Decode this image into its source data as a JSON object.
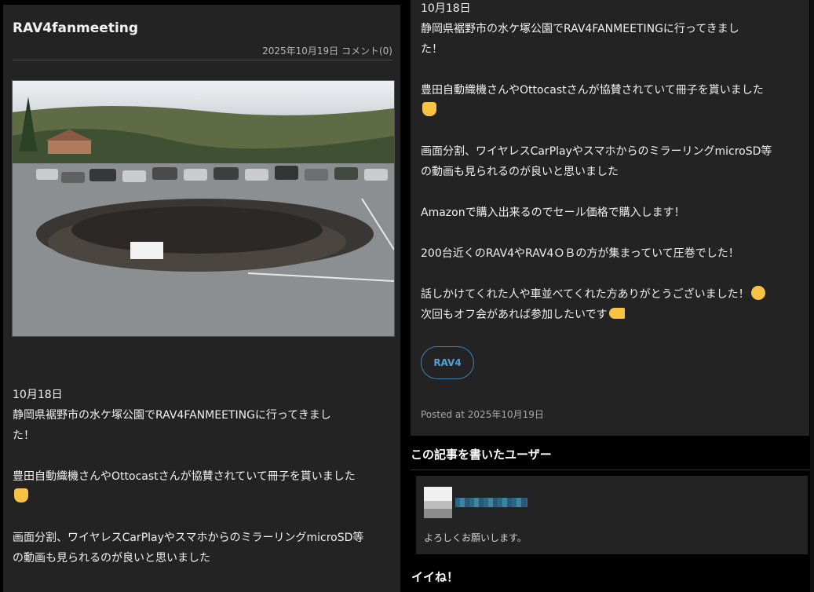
{
  "article": {
    "title": "RAV4fanmeeting",
    "meta": "2025年10月19日 コメント(0)",
    "photo_alt": "group-photo",
    "paragraphs": [
      "10月18日\n静岡県裾野市の水ケ塚公園でRAV4FANMEETINGに行ってきまし\nた！",
      "豊田自動織機さんやOttocastさんが協賛されていて冊子を貰いました",
      "画面分割、ワイヤレスCarPlayやスマホからのミラーリングmicroSD等\nの動画も見られるのが良いと思いました"
    ],
    "right_paragraphs": [
      "10月18日\n静岡県裾野市の水ケ塚公園でRAV4FANMEETINGに行ってきまし\nた！",
      "豊田自動織機さんやOttocastさんが協賛されていて冊子を貰いました",
      "画面分割、ワイヤレスCarPlayやスマホからのミラーリングmicroSD等\nの動画も見られるのが良いと思いました",
      "Amazonで購入出来るのでセール価格で購入します！",
      "200台近くのRAV4やRAV4ＯＢの方が集まっていて圧巻でした！",
      "話しかけてくれた人や車並べてくれた方ありがとうございました！",
      "次回もオフ会があれば参加したいです"
    ],
    "tag": "RAV4",
    "posted": "Posted at 2025年10月19日"
  },
  "author": {
    "heading": "この記事を書いたユーザー",
    "bio": "よろしくお願いします。"
  },
  "likes": {
    "heading": "イイね！"
  },
  "icons": {
    "thumb": "thumbs-up-icon",
    "smile": "smile-icon",
    "point": "pointing-hand-icon"
  }
}
